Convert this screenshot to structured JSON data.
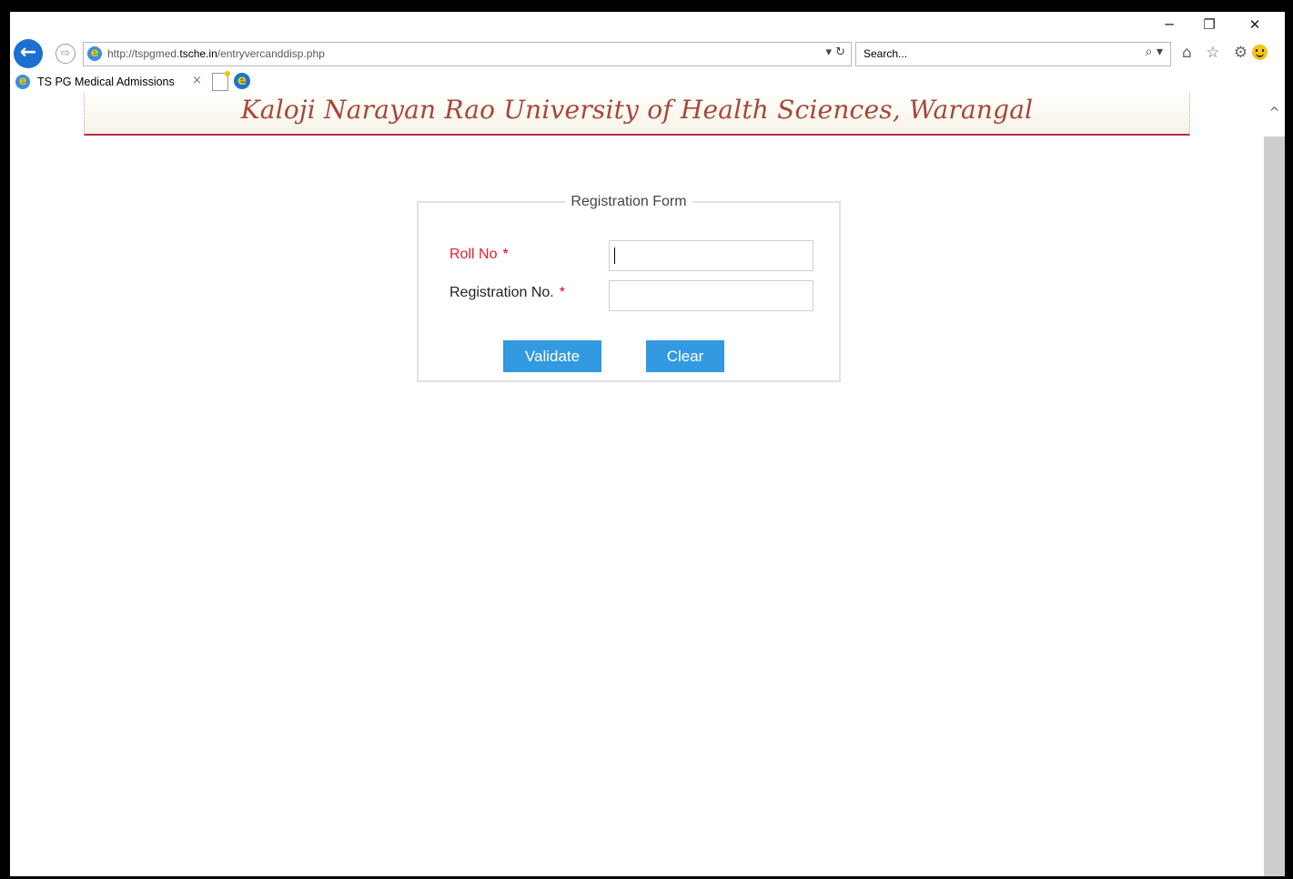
{
  "browser": {
    "address_url_prefix": "http://tspgmed.",
    "address_url_domain": "tsche.in",
    "address_url_path": "/entryvercanddisp.php",
    "address_tools": "▾ ↻",
    "search_placeholder": "Search...",
    "search_tools": "⌕ ▾",
    "window_minimize": "─",
    "window_restore": "❐",
    "window_close": "✕",
    "toolbar_icons": "⌂ ☆ ⚙"
  },
  "tabs": [
    {
      "title": "TS PG Medical Admissions",
      "close": "×"
    }
  ],
  "page": {
    "banner_title": "Kaloji Narayan Rao University of Health Sciences, Warangal",
    "form": {
      "legend": "Registration Form",
      "roll_label": "Roll No",
      "roll_value": "",
      "reg_label": "Registration No.",
      "reg_value": "",
      "required_mark": "*",
      "validate_label": "Validate",
      "clear_label": "Clear"
    }
  },
  "colors": {
    "button_bg": "#3399e0",
    "banner_text": "#a8463a",
    "banner_rule": "#c0284c",
    "required": "#d9001b"
  }
}
